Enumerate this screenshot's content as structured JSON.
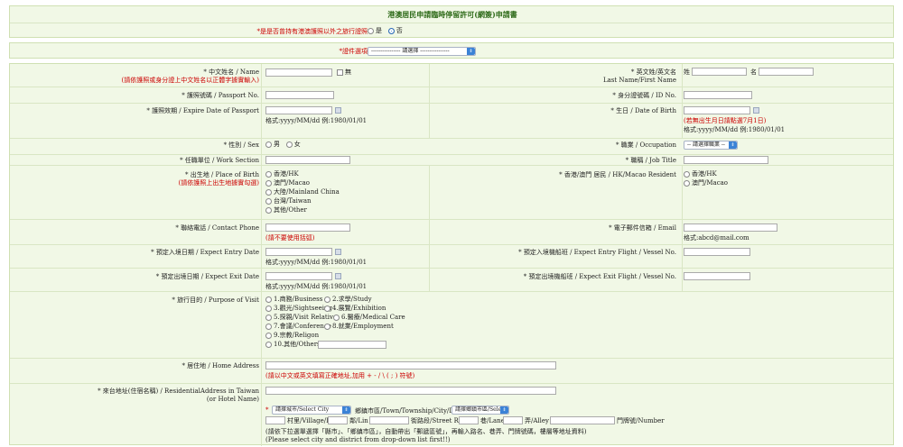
{
  "form": {
    "title": "港澳居民申請臨時停留許可(網簽)申請書",
    "passport_question": "*是是否曾持有港澳護照以外之旅行證照",
    "opt_yes": "是",
    "opt_no": "否"
  },
  "category": {
    "label": "*證件選項",
    "select_value": "---------------- 請選擇 ----------------"
  },
  "fields": {
    "name_cn": "* 中文姓名 / Name",
    "name_cn_note": "(請依護照或身分證上中文姓名以正體字據實輸入)",
    "name_none": "無",
    "name_en_line1": "* 英文姓/英文名",
    "name_en_line2": "Last Name/First Name",
    "surname": "姓",
    "given": "名",
    "passport_no": "* 護照號碼 / Passport No.",
    "id_no": "* 身分證號碼 / ID No.",
    "passport_exp": "* 護照效期 / Expire Date of Passport",
    "date_format": "格式:yyyy/MM/dd    例:1980/01/01",
    "dob": "* 生日 / Date of Birth",
    "dob_note": "(若無出生月日請點選7月1日)",
    "sex": "* 性別 / Sex",
    "male": "男",
    "female": "女",
    "occupation": "* 職業 / Occupation",
    "occupation_select": "-- 請選擇職業 --",
    "work_section": "* 任職單位 / Work Section",
    "job_title": "* 職稱 / Job Title",
    "pob": "* 出生地 / Place of Birth",
    "pob_note": "(請依護照上出生地據實勾選)",
    "pob_options": [
      "香港/HK",
      "澳門/Macao",
      "大陸/Mainland China",
      "台灣/Taiwan",
      "其他/Other"
    ],
    "resident": "* 香港/澳門 居民 / HK/Macao Resident",
    "resident_options": [
      "香港/HK",
      "澳門/Macao"
    ],
    "phone": "* 聯絡電話 / Contact Phone",
    "phone_note": "(請不要使用括弧)",
    "email": "* 電子郵件信箱 / Email",
    "email_format": "格式:abcd@mail.com",
    "entry_date": "* 預定入境日期 / Expect Entry Date",
    "entry_flight": "* 預定入境機船班 / Expect Entry Flight / Vessel No.",
    "exit_date": "* 預定出境日期 / Expect Exit Date",
    "exit_flight": "* 預定出境機船班 / Expect Exit Flight / Vessel No.",
    "purpose": "* 旅行目的 / Purpose of Visit",
    "purpose_options": [
      [
        "1.商務/Business",
        "2.求學/Study"
      ],
      [
        "3.觀光/Sightseeing",
        "4.展覽/Exhibition"
      ],
      [
        "5.探親/Visit Relative",
        "6.醫療/Medical Care"
      ],
      [
        "7.會議/Conference",
        "8.就業/Employment"
      ],
      [
        "9.宗教/Religon",
        ""
      ],
      [
        "10.其他/Others",
        ""
      ]
    ],
    "home_addr": "* 居住地 / Home Address",
    "home_addr_note": "(請以中文或英文填寫正確地址,加用 + - / \\ ( ; ) 符號)",
    "tw_addr_line1": "* 來台地址(住宿名稱) / ResidentialAddress in Taiwan",
    "tw_addr_line2": "(or Hotel Name)",
    "city_select": "請擇城市/Select City",
    "district_label": "鄉鎮市區/Town/Township/City/District",
    "district_select": "請擇鄉鎮市區/Select",
    "village": "村里/Village/Li",
    "lin": "鄰/Lin",
    "street": "街路段/Street Road",
    "lane": "巷/Lane",
    "alley": "弄/Alley",
    "number": "門牌號/Number",
    "addr_note1": "(請依下拉選單選擇「縣市」、「鄉鎮市區」，自動帶出「郵遞區號」，再輸入路名、巷弄、門牌號碼，樓層等地址資料)",
    "addr_note2": "(Please select city and district from drop-down list first!!)"
  }
}
